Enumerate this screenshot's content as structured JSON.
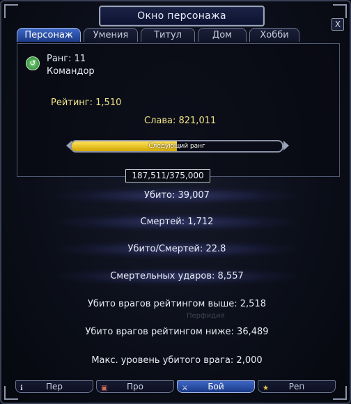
{
  "window": {
    "title": "Окно персонажа",
    "close_label": "X"
  },
  "tabs": [
    {
      "label": "Персонаж",
      "active": true
    },
    {
      "label": "Умения"
    },
    {
      "label": "Титул"
    },
    {
      "label": "Дом"
    },
    {
      "label": "Хобби"
    }
  ],
  "character": {
    "rank": "Ранг: 11",
    "rank_title": "Командор",
    "rating": "Рейтинг: 1,510",
    "glory": "Слава: 821,011",
    "next_rank_label": "Следующий ранг",
    "next_rank_progress": 0.5,
    "progress_text": "187,511/375,000"
  },
  "stats": [
    "Убито: 39,007",
    "Смертей: 1,712",
    "Убито/Смертей: 22.8",
    "Смертельных ударов: 8,557",
    "Убито врагов рейтингом выше: 2,518",
    "Убито врагов рейтингом ниже: 36,489",
    "Макс. уровень убитого врага: 2,000"
  ],
  "bottom_tabs": [
    {
      "label": "Пер",
      "icon": "info-icon",
      "glyph": "ℹ"
    },
    {
      "label": "Про",
      "icon": "profile-icon",
      "glyph": "▣"
    },
    {
      "label": "Бой",
      "icon": "battle-icon",
      "glyph": "⚔",
      "active": true
    },
    {
      "label": "Реп",
      "icon": "reputation-icon",
      "glyph": "★"
    }
  ],
  "watermark": "Перфидия",
  "colors": {
    "accent": "#2f5bbf",
    "gold": "#f0e38a",
    "bar_fill": "#ffd21f"
  }
}
